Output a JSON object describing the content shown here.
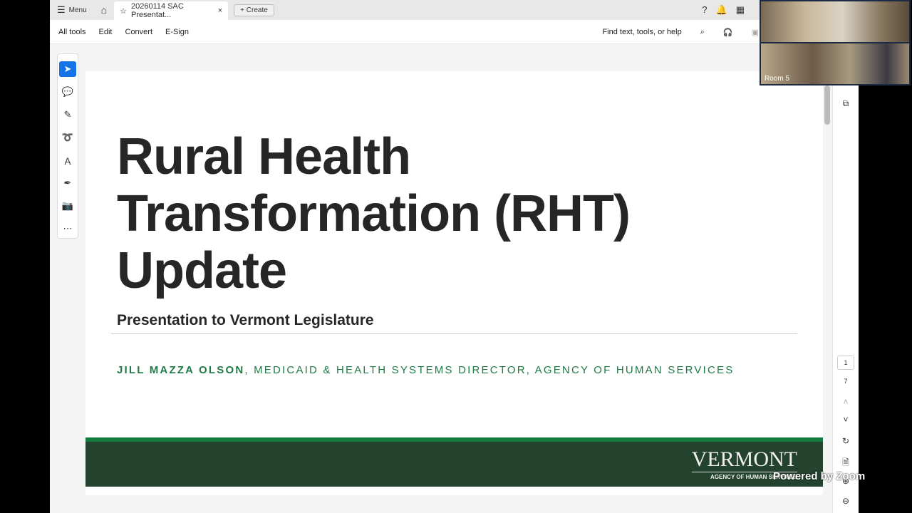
{
  "topbar": {
    "menu": "Menu",
    "tab_title": "20260114 SAC Presentat...",
    "create": "Create"
  },
  "toolbar": {
    "items": [
      "All tools",
      "Edit",
      "Convert",
      "E-Sign"
    ],
    "find": "Find text, tools, or help"
  },
  "slide": {
    "title_lines": [
      "Rural Health",
      "Transformation (RHT)",
      "Update"
    ],
    "subtitle": "Presentation to Vermont Legislature",
    "author_name": "JILL MAZZA OLSON",
    "author_role": ", MEDICAID & HEALTH SYSTEMS DIRECTOR, AGENCY OF HUMAN SERVICES",
    "logo_main": "VERMONT",
    "logo_sub": "AGENCY OF HUMAN SERVICES"
  },
  "pager": {
    "current": "1",
    "total": "7"
  },
  "video": {
    "room": "Room 5",
    "watermark": "Powered by Zoom"
  }
}
